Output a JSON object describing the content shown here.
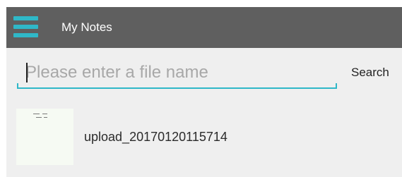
{
  "toolbar": {
    "menu_icon": "hamburger-menu-icon",
    "title": "My Notes",
    "background_color": "#5f5f5f",
    "accent_color": "#2fb8c8"
  },
  "search": {
    "value": "",
    "placeholder": "Please enter a file name",
    "button_label": "Search"
  },
  "files": [
    {
      "name": "upload_20170120115714",
      "thumbnail_icon": "note-thumbnail"
    }
  ]
}
